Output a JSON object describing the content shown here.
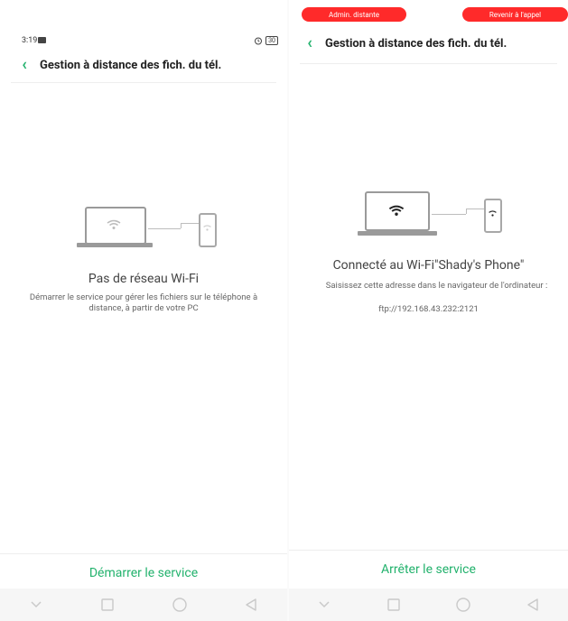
{
  "left": {
    "status": {
      "time": "3:19",
      "battery": "30"
    },
    "header": {
      "title": "Gestion à distance des fich. du tél."
    },
    "heading": "Pas de réseau Wi-Fi",
    "description": "Démarrer le service pour gérer les fichiers sur le téléphone à distance, à partir de votre PC",
    "action": "Démarrer le service"
  },
  "right": {
    "pills": {
      "remote_admin": "Admin. distante",
      "back_to_call": "Revenir à l'appel"
    },
    "header": {
      "title": "Gestion à distance des fich. du tél."
    },
    "heading": "Connecté au Wi-Fi\"Shady's Phone\"",
    "description_line1": "Saisissez cette adresse dans le navigateur de l'ordinateur :",
    "address": "ftp://192.168.43.232:2121",
    "action": "Arrêter le service"
  },
  "colors": {
    "accent": "#23b26d",
    "alert": "#ff2a2a"
  },
  "icons": [
    "back-arrow-icon",
    "wifi-icon",
    "laptop-icon",
    "phone-icon",
    "alarm-icon",
    "battery-icon",
    "nav-down-icon",
    "nav-square-icon",
    "nav-circle-icon",
    "nav-back-icon"
  ]
}
